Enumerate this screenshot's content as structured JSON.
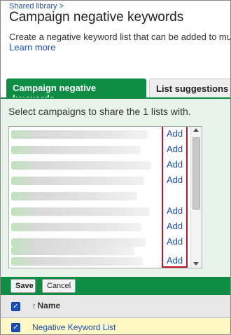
{
  "breadcrumb": "Shared library >",
  "title": "Campaign negative keywords",
  "description": "Create a negative keyword list that can be added to mu",
  "learn_more": "Learn more",
  "tabs": [
    {
      "label": "Campaign negative keywords",
      "active": true
    },
    {
      "label": "List suggestions",
      "active": false
    }
  ],
  "panel": {
    "heading": "Select campaigns to share the 1 lists with.",
    "campaigns": [
      {
        "name": "",
        "action": "Add"
      },
      {
        "name": "",
        "action": "Add"
      },
      {
        "name": "",
        "action": "Add"
      },
      {
        "name": "",
        "action": "Add"
      },
      {
        "name": "",
        "action": ""
      },
      {
        "name": "",
        "action": "Add"
      },
      {
        "name": "",
        "action": "Add"
      },
      {
        "name": "",
        "action": "Add"
      },
      {
        "name": "",
        "action": ""
      },
      {
        "name": "",
        "action": "Add"
      }
    ]
  },
  "actions": {
    "save": "Save",
    "cancel": "Cancel"
  },
  "table": {
    "header": "Name",
    "rows": [
      {
        "name": "Negative Keyword List",
        "checked": true
      }
    ]
  },
  "colors": {
    "accent": "#0e8d45",
    "link": "#1a4fbd",
    "highlight": "#c0162c",
    "selected_row": "#fff7c4"
  }
}
